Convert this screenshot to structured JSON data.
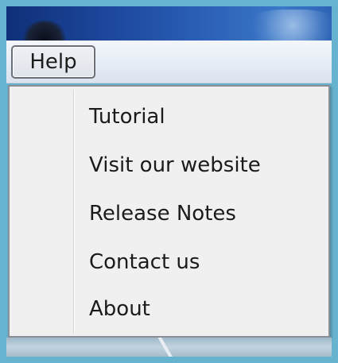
{
  "menubar": {
    "help_label": "Help"
  },
  "dropdown": {
    "items": [
      {
        "label": "Tutorial"
      },
      {
        "label": "Visit our website"
      },
      {
        "label": "Release Notes"
      },
      {
        "label": "Contact us"
      },
      {
        "label": "About"
      }
    ]
  },
  "colors": {
    "title_strip": "#1e4aa0",
    "menu_background": "#f0f0f0",
    "frame": "#66b3cf"
  }
}
